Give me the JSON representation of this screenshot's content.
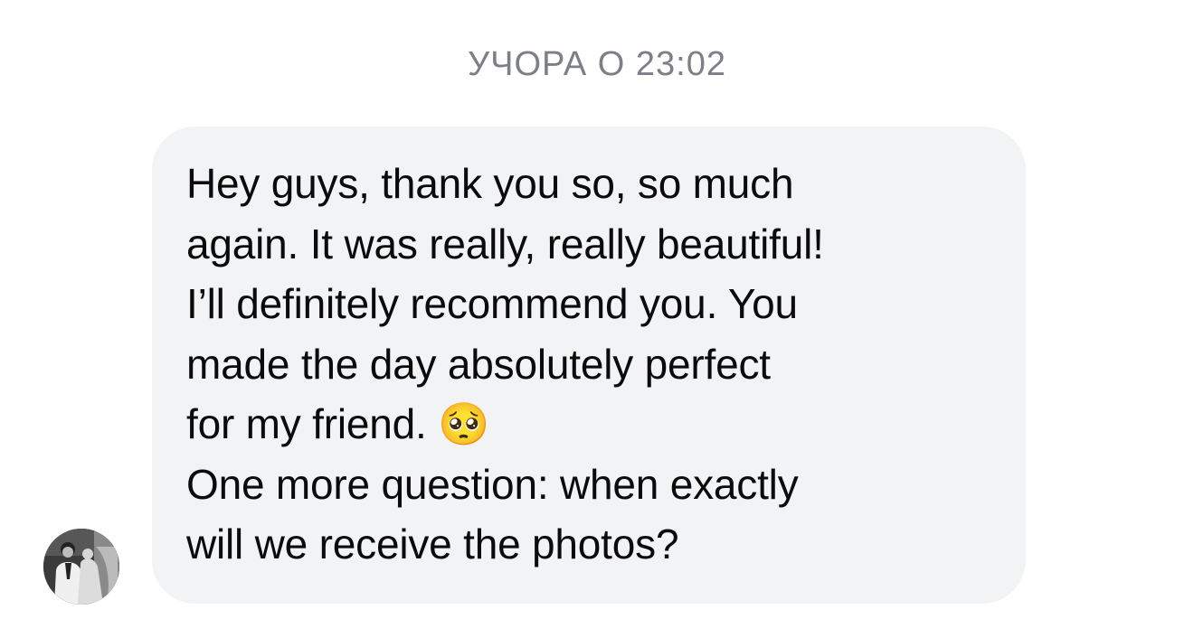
{
  "conversation": {
    "timestamp": "УЧОРА О 23:02"
  },
  "message": {
    "sender_avatar_icon": "profile-photo-avatar",
    "text": "Hey guys, thank you so, so much\nagain. It was really, really beautiful!\nI’ll definitely recommend you. You\nmade the day absolutely perfect\nfor my friend. 🥺\nOne more question: when exactly\nwill we receive the photos?"
  },
  "colors": {
    "background": "#ffffff",
    "bubble": "#f2f3f5",
    "timestamp_text": "#7c7f86",
    "message_text": "#0b0b0b"
  }
}
